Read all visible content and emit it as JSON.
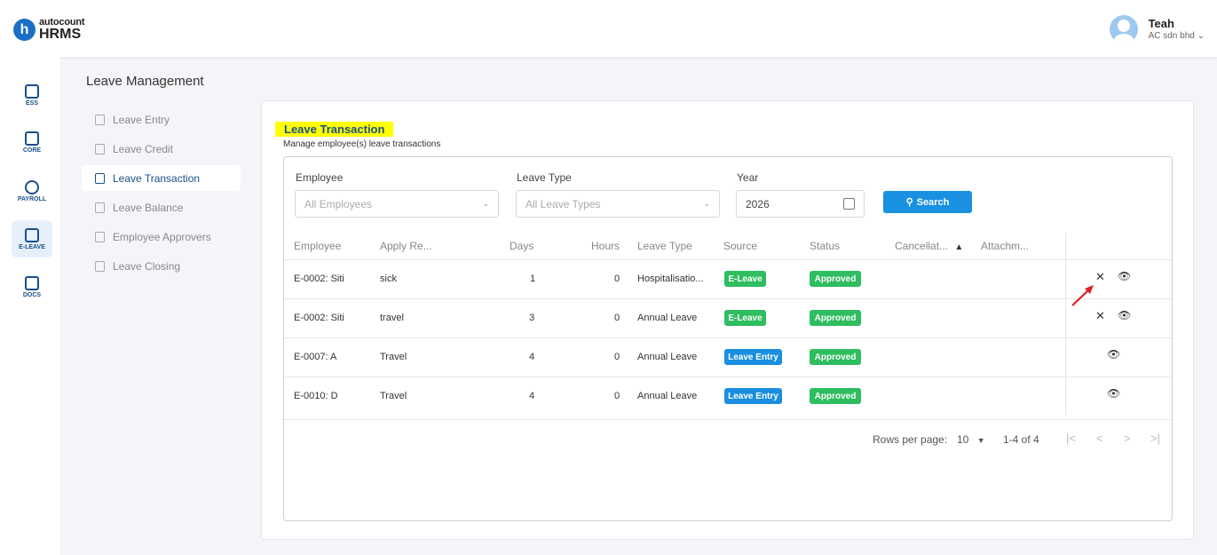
{
  "brand": {
    "small": "autocount",
    "big": "HRMS",
    "mark": "h"
  },
  "user": {
    "name": "Teah",
    "company": "AC sdn bhd",
    "chevron": "⌄"
  },
  "rail": [
    {
      "label": "ESS",
      "icon": "ess-icon"
    },
    {
      "label": "CORE",
      "icon": "core-icon"
    },
    {
      "label": "PAYROLL",
      "icon": "payroll-icon"
    },
    {
      "label": "E-LEAVE",
      "icon": "eleave-icon"
    },
    {
      "label": "DOCS",
      "icon": "docs-icon"
    }
  ],
  "subnav": {
    "title": "Leave Management",
    "items": [
      "Leave Entry",
      "Leave Credit",
      "Leave Transaction",
      "Leave Balance",
      "Employee Approvers",
      "Leave Closing"
    ]
  },
  "page": {
    "title": "Leave Transaction",
    "subtitle": "Manage employee(s) leave transactions"
  },
  "filters": {
    "employee_label": "Employee",
    "employee_placeholder": "All Employees",
    "leave_type_label": "Leave Type",
    "leave_type_placeholder": "All Leave Types",
    "year_label": "Year",
    "year_value": "2026",
    "search_label": "Search"
  },
  "table": {
    "headers": [
      "Employee",
      "Apply Re...",
      "Days",
      "Hours",
      "Leave Type",
      "Source",
      "Status",
      "Cancellat...",
      "Attachm..."
    ],
    "sort_indicator": "▲",
    "rows": [
      {
        "employee": "E-0002: Siti",
        "reason": "sick",
        "days": "1",
        "hours": "0",
        "leave_type": "Hospitalisatio...",
        "source": "E-Leave",
        "status": "Approved"
      },
      {
        "employee": "E-0002: Siti",
        "reason": "travel",
        "days": "3",
        "hours": "0",
        "leave_type": "Annual Leave",
        "source": "E-Leave",
        "status": "Approved"
      },
      {
        "employee": "E-0007: A",
        "reason": "Travel",
        "days": "4",
        "hours": "0",
        "leave_type": "Annual Leave",
        "source": "Leave Entry",
        "status": "Approved"
      },
      {
        "employee": "E-0010: D",
        "reason": "Travel",
        "days": "4",
        "hours": "0",
        "leave_type": "Annual Leave",
        "source": "Leave Entry",
        "status": "Approved"
      }
    ],
    "actions": {
      "cancel": "✕",
      "view": "👁"
    }
  },
  "pagination": {
    "rows_per_page_label": "Rows per page:",
    "rows_per_page_value": "10",
    "range": "1-4 of 4",
    "first": "|<",
    "prev": "<",
    "next": ">",
    "last": ">|"
  },
  "colors": {
    "accent": "#1a90e0",
    "approved": "#2ebd5f",
    "source_leave_entry": "#1a8ee0",
    "highlight": "#ffff00"
  }
}
